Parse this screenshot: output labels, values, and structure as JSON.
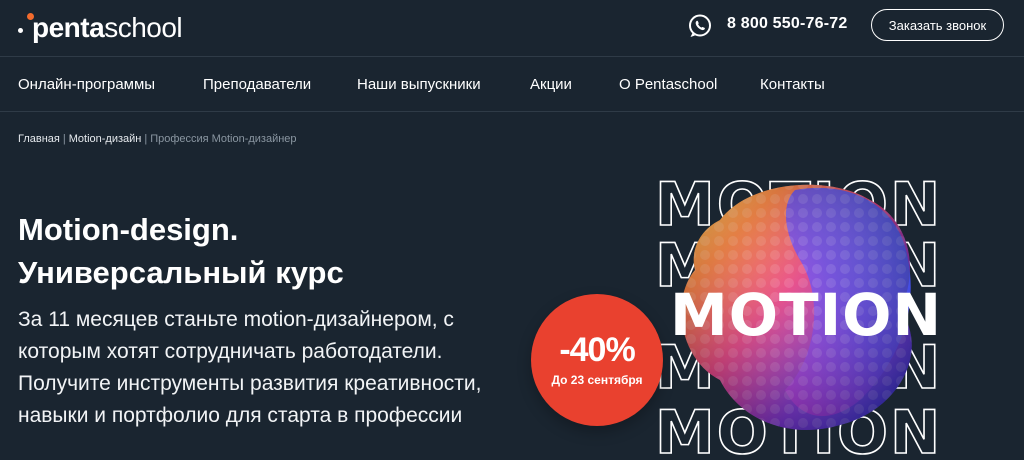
{
  "header": {
    "logo": {
      "bold": "penta",
      "light": "school"
    },
    "phone": "8 800 550-76-72",
    "callback_label": "Заказать звонок",
    "messenger_icon": "whatsapp-icon"
  },
  "nav": {
    "items": [
      {
        "label": "Онлайн-программы"
      },
      {
        "label": "Преподаватели"
      },
      {
        "label": "Наши выпускники"
      },
      {
        "label": "Акции"
      },
      {
        "label": "О Pentaschool"
      },
      {
        "label": "Контакты"
      }
    ]
  },
  "breadcrumb": {
    "home": "Главная",
    "section": "Motion-дизайн",
    "current": "Профессия Motion-дизайнер",
    "separator": "|"
  },
  "hero": {
    "title_line1": "Motion-design.",
    "title_line2": "Универсальный курс",
    "desc_line1": "За 11 месяцев станьте motion-дизайнером, с",
    "desc_line2": "которым хотят сотрудничать работодатели.",
    "desc_line3": "Получите инструменты развития креативности,",
    "desc_line4": "навыки и портфолио для старта в профессии"
  },
  "promo": {
    "discount": "-40%",
    "until": "До 23 сентября",
    "color": "#e9412f"
  },
  "visual": {
    "word": "MOTION"
  },
  "colors": {
    "background": "#1a2530",
    "accent": "#f26b2d"
  }
}
